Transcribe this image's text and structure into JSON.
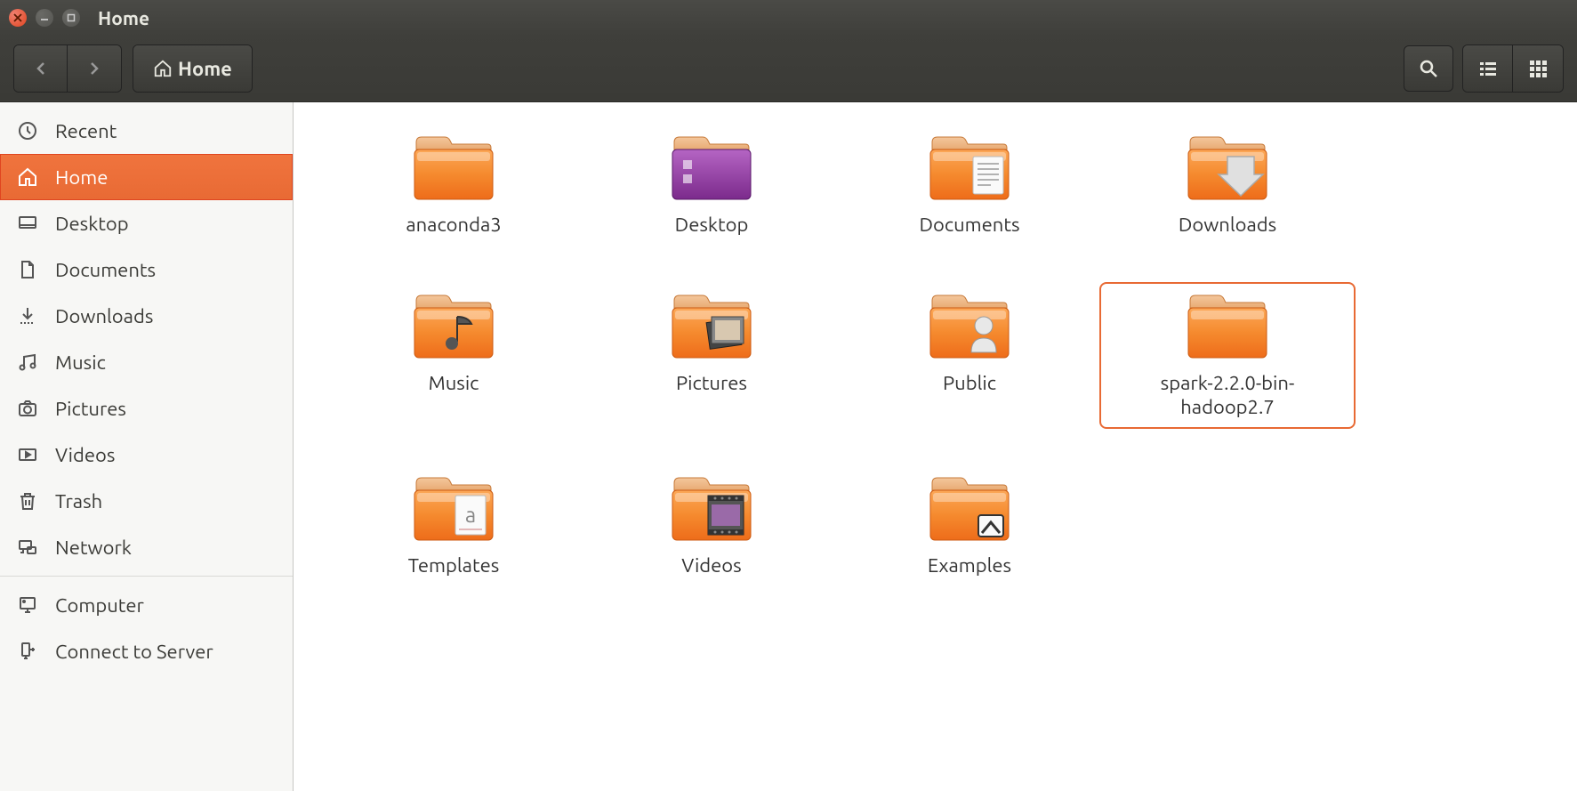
{
  "window": {
    "title": "Home"
  },
  "toolbar": {
    "breadcrumb": "Home"
  },
  "sidebar": {
    "places": [
      {
        "id": "recent",
        "label": "Recent",
        "icon": "clock"
      },
      {
        "id": "home",
        "label": "Home",
        "icon": "home",
        "active": true
      },
      {
        "id": "desktop",
        "label": "Desktop",
        "icon": "desktop"
      },
      {
        "id": "documents",
        "label": "Documents",
        "icon": "document"
      },
      {
        "id": "downloads",
        "label": "Downloads",
        "icon": "download"
      },
      {
        "id": "music",
        "label": "Music",
        "icon": "music"
      },
      {
        "id": "pictures",
        "label": "Pictures",
        "icon": "camera"
      },
      {
        "id": "videos",
        "label": "Videos",
        "icon": "video"
      },
      {
        "id": "trash",
        "label": "Trash",
        "icon": "trash"
      },
      {
        "id": "network",
        "label": "Network",
        "icon": "network"
      }
    ],
    "devices": [
      {
        "id": "computer",
        "label": "Computer",
        "icon": "computer"
      },
      {
        "id": "connect",
        "label": "Connect to Server",
        "icon": "server"
      }
    ]
  },
  "main": {
    "items": [
      {
        "label": "anaconda3",
        "type": "folder"
      },
      {
        "label": "Desktop",
        "type": "folder-desktop"
      },
      {
        "label": "Documents",
        "type": "folder-documents"
      },
      {
        "label": "Downloads",
        "type": "folder-downloads"
      },
      {
        "label": "Music",
        "type": "folder-music"
      },
      {
        "label": "Pictures",
        "type": "folder-pictures"
      },
      {
        "label": "Public",
        "type": "folder-public"
      },
      {
        "label": "spark-2.2.0-bin-hadoop2.7",
        "type": "folder",
        "highlighted": true
      },
      {
        "label": "Templates",
        "type": "folder-templates"
      },
      {
        "label": "Videos",
        "type": "folder-videos"
      },
      {
        "label": "Examples",
        "type": "folder-examples"
      }
    ]
  }
}
